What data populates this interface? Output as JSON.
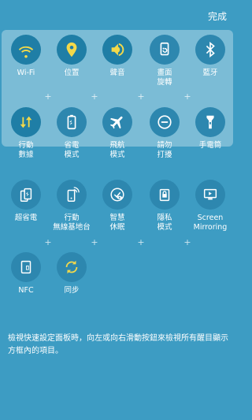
{
  "header": {
    "done_label": "完成"
  },
  "active": {
    "row1": [
      {
        "label": "Wi-Fi",
        "icon": "wifi-icon"
      },
      {
        "label": "位置",
        "icon": "location-pin-icon"
      },
      {
        "label": "聲音",
        "icon": "sound-icon"
      },
      {
        "label": "畫面\n旋轉",
        "icon": "screen-rotation-icon"
      },
      {
        "label": "藍牙",
        "icon": "bluetooth-icon"
      }
    ],
    "row2": [
      {
        "label": "行動\n數據",
        "icon": "mobile-data-icon"
      },
      {
        "label": "省電\n模式",
        "icon": "power-saving-icon"
      },
      {
        "label": "飛航\n模式",
        "icon": "airplane-icon"
      },
      {
        "label": "請勿\n打擾",
        "icon": "do-not-disturb-icon"
      },
      {
        "label": "手電筒",
        "icon": "flashlight-icon"
      }
    ]
  },
  "available": {
    "row1": [
      {
        "label": "超省電",
        "icon": "ultra-power-saving-icon"
      },
      {
        "label": "行動\n無線基地台",
        "icon": "mobile-hotspot-icon"
      },
      {
        "label": "智慧\n休眠",
        "icon": "smart-stay-icon"
      },
      {
        "label": "隱私\n模式",
        "icon": "private-mode-icon"
      },
      {
        "label": "Screen\nMirroring",
        "icon": "screen-mirroring-icon"
      }
    ],
    "row2": [
      {
        "label": "NFC",
        "icon": "nfc-icon"
      },
      {
        "label": "同步",
        "icon": "sync-icon"
      }
    ]
  },
  "footer": {
    "instruction": "檢視快速設定面板時，向左或向右滑動按鈕來檢視所有醒目顯示方框內的項目。"
  },
  "colors": {
    "background": "#3d9cc3",
    "circle": "#1f7ea6"
  }
}
